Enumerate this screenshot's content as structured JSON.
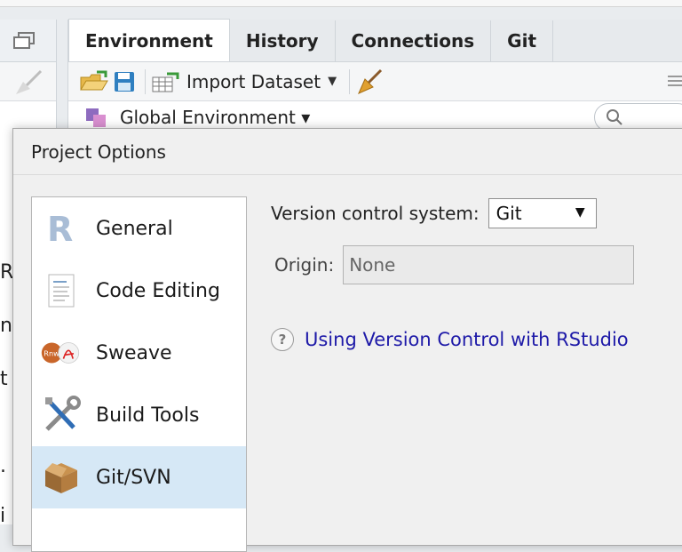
{
  "background": {
    "tabs": [
      {
        "label": "Environment",
        "active": true
      },
      {
        "label": "History",
        "active": false
      },
      {
        "label": "Connections",
        "active": false
      },
      {
        "label": "Git",
        "active": false
      }
    ],
    "toolbar": {
      "import_label": "Import Dataset"
    },
    "environment_label": "Global Environment",
    "left_pane_fragments": [
      "R",
      "n",
      "t",
      ".",
      "i"
    ]
  },
  "dialog": {
    "title": "Project Options",
    "sidebar": {
      "items": [
        {
          "label": "General",
          "icon": "r-logo-icon",
          "selected": false
        },
        {
          "label": "Code Editing",
          "icon": "document-icon",
          "selected": false
        },
        {
          "label": "Sweave",
          "icon": "sweave-pdf-icon",
          "selected": false
        },
        {
          "label": "Build Tools",
          "icon": "tools-icon",
          "selected": false
        },
        {
          "label": "Git/SVN",
          "icon": "package-box-icon",
          "selected": true
        }
      ]
    },
    "vcs": {
      "label": "Version control system:",
      "value": "Git"
    },
    "origin": {
      "label": "Origin:",
      "value": "None"
    },
    "help": {
      "icon_text": "?",
      "link_text": "Using Version Control with RStudio"
    }
  },
  "colors": {
    "link": "#1e1aa8",
    "selected_row": "#d6e8f6",
    "dialog_bg": "#f0f0f0"
  }
}
